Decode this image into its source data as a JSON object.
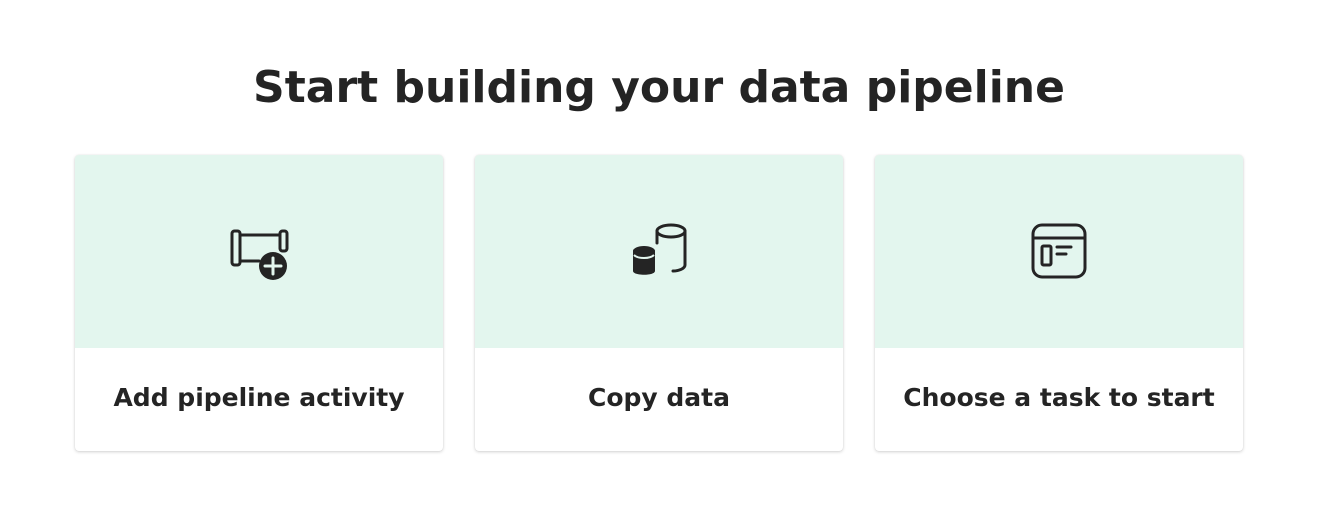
{
  "page": {
    "title": "Start building your data pipeline"
  },
  "cards": [
    {
      "label": "Add pipeline activity",
      "icon": "pipeline-add-icon"
    },
    {
      "label": "Copy data",
      "icon": "database-copy-icon"
    },
    {
      "label": "Choose a task to start",
      "icon": "template-window-icon"
    }
  ],
  "colors": {
    "card_top": "#e3f6ee",
    "text": "#242424",
    "background": "#ffffff"
  }
}
